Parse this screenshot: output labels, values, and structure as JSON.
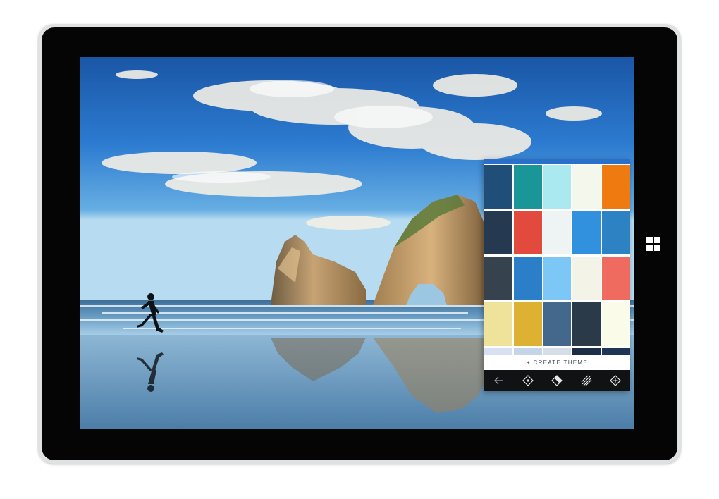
{
  "panel": {
    "create_theme_label": "+ CREATE THEME",
    "palettes": [
      {
        "colors": [
          "#1f4e79",
          "#1a9699",
          "#a9e9ef",
          "#f4f7ec",
          "#ee7a10"
        ]
      },
      {
        "colors": [
          "#253a50",
          "#e14a3c",
          "#eef3f4",
          "#3291df",
          "#2d82c4"
        ]
      },
      {
        "colors": [
          "#36424d",
          "#2a7fc8",
          "#7cc7f6",
          "#f4f3e8",
          "#f06b5f"
        ]
      },
      {
        "colors": [
          "#efe29b",
          "#ddb233",
          "#44688c",
          "#2a3a48",
          "#fbfbea"
        ]
      }
    ],
    "peek_colors": [
      "#d7e1f1",
      "#c5d4e6",
      "#d5dde7",
      "#1c2e47",
      "#1f3555"
    ]
  },
  "toolbar": {
    "icons": [
      "back-arrow-icon",
      "compass-icon",
      "eraser-icon",
      "stripes-icon",
      "shapes-icon"
    ]
  },
  "colors": {
    "accent": "#2a6fc9",
    "toolbar_bg": "#111214",
    "bezel": "#050505"
  }
}
